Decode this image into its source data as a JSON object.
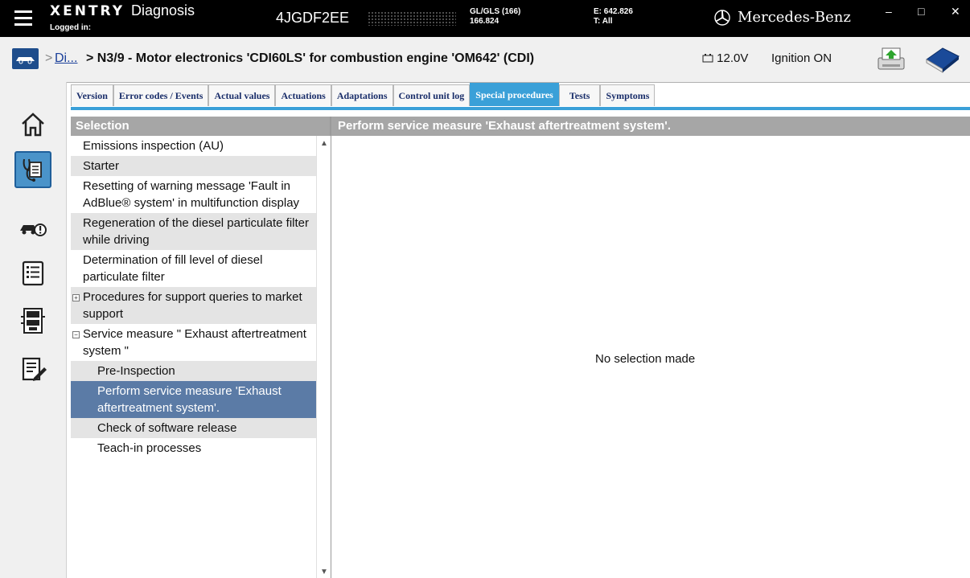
{
  "titlebar": {
    "brand": "XENTRY",
    "app": "Diagnosis",
    "logged_in": "Logged in:",
    "vin": "4JGDF2EE",
    "model_line1": "GL/GLS (166)",
    "model_line2": "166.824",
    "engine_line1": "E: 642.826",
    "engine_line2": "T: All",
    "manufacturer": "Mercedes-Benz",
    "minimize": "–",
    "maximize": "□",
    "close": "✕"
  },
  "breadcrumb": {
    "separator": ">",
    "link": "Di...",
    "title": "> N3/9 - Motor electronics 'CDI60LS' for combustion engine 'OM642' (CDI)",
    "battery": "12.0V",
    "ignition": "Ignition ON"
  },
  "tabs": [
    {
      "label": "Version"
    },
    {
      "label": "Error codes / Events"
    },
    {
      "label": "Actual values"
    },
    {
      "label": "Actuations"
    },
    {
      "label": "Adaptations"
    },
    {
      "label": "Control unit log"
    },
    {
      "label": "Special procedures"
    },
    {
      "label": "Tests"
    },
    {
      "label": "Symptoms"
    }
  ],
  "active_tab": "Special procedures",
  "selection": {
    "header": "Selection",
    "items": [
      {
        "label": "Emissions inspection (AU)"
      },
      {
        "label": "Starter"
      },
      {
        "label": "Resetting of warning message 'Fault in AdBlue® system' in multifunction display"
      },
      {
        "label": "Regeneration of the diesel particulate filter while driving"
      },
      {
        "label": "Determination of fill level of diesel particulate filter"
      },
      {
        "label": "Procedures for support queries to market support",
        "expander": "+"
      },
      {
        "label": "Service measure \" Exhaust aftertreatment system \"",
        "expander": "−"
      },
      {
        "label": "Pre-Inspection"
      },
      {
        "label": "Perform service measure 'Exhaust aftertreatment system'."
      },
      {
        "label": "Check of software release"
      },
      {
        "label": "Teach-in processes"
      }
    ]
  },
  "main": {
    "header": "Perform service measure 'Exhaust aftertreatment system'.",
    "empty_message": "No selection made"
  },
  "colors": {
    "accent": "#3aa0d8",
    "selected_row": "#5b7ba6",
    "panel_header": "#a6a6a6"
  },
  "icons": {
    "sidebar": [
      "home-icon",
      "diagnosis-icon",
      "vehicle-warning-icon",
      "list-icon",
      "control-units-icon",
      "notepad-icon"
    ],
    "toolbar": [
      "printer-icon",
      "manual-book-icon"
    ]
  }
}
